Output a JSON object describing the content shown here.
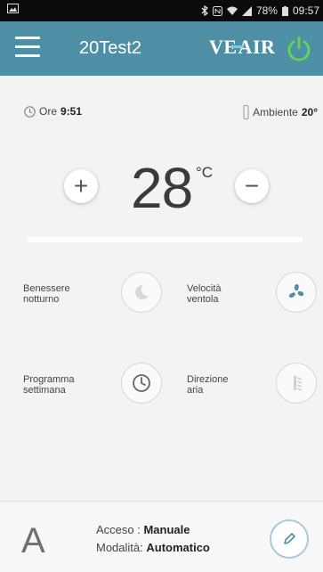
{
  "status_bar": {
    "battery": "78%",
    "time": "09:57"
  },
  "app_bar": {
    "device_name": "20Test2",
    "brand": {
      "left": "VE",
      "right": "AIR"
    },
    "accent_color": "#4e8fa6",
    "power_color": "#5fd35a"
  },
  "info": {
    "clock_label": "Ore",
    "clock_time": "9:51",
    "ambient_label": "Ambiente",
    "ambient_value": "20°"
  },
  "temperature": {
    "plus_label": "+",
    "minus_label": "−",
    "value": "28",
    "unit": "°C"
  },
  "functions": [
    {
      "label_line1": "Benessere",
      "label_line2": "notturno",
      "icon": "moon-icon"
    },
    {
      "label_line1": "Velocità",
      "label_line2": "ventola",
      "icon": "fan-icon"
    },
    {
      "label_line1": "Programma",
      "label_line2": "settimana",
      "icon": "clock-icon"
    },
    {
      "label_line1": "Direzione",
      "label_line2": "aria",
      "icon": "louver-icon"
    }
  ],
  "bottom": {
    "mode_letter": "A",
    "acceso_label": "Acceso : ",
    "acceso_value": "Manuale",
    "modalita_label": "Modalità: ",
    "modalita_value": "Automatico"
  }
}
